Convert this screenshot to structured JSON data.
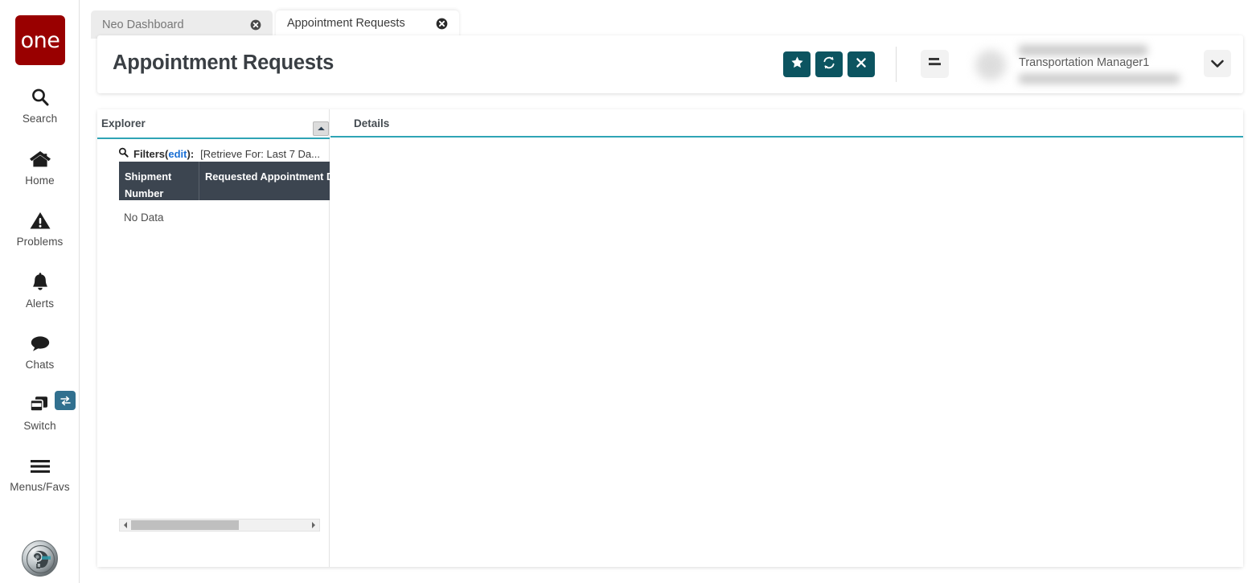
{
  "brand": {
    "logo_text": "one",
    "logo_color": "#990000"
  },
  "theme": {
    "accent_teal": "#0c5460",
    "panel_underline": "#2fa4b5",
    "grid_header_bg": "#3c4550",
    "link_blue": "#1a6fd4",
    "badge_blue": "#31708f"
  },
  "sidebar": {
    "items": [
      {
        "label": "Search",
        "icon": "search-icon"
      },
      {
        "label": "Home",
        "icon": "home-icon"
      },
      {
        "label": "Problems",
        "icon": "warning-triangle-icon"
      },
      {
        "label": "Alerts",
        "icon": "bell-icon"
      },
      {
        "label": "Chats",
        "icon": "chat-bubble-icon"
      },
      {
        "label": "Switch",
        "icon": "switch-windows-icon",
        "badge_icon": "swap-arrows-icon"
      },
      {
        "label": "Menus/Favs",
        "icon": "hamburger-icon"
      }
    ],
    "assistant_icon": "ai-assistant-orb-icon"
  },
  "tabs": [
    {
      "label": "Neo Dashboard",
      "active": false,
      "close_icon": "close-circle-icon"
    },
    {
      "label": "Appointment Requests",
      "active": true,
      "close_icon": "close-circle-icon"
    }
  ],
  "header": {
    "title": "Appointment Requests",
    "buttons": [
      {
        "name": "favorite-button",
        "icon": "star-icon"
      },
      {
        "name": "refresh-button",
        "icon": "refresh-icon"
      },
      {
        "name": "close-button",
        "icon": "x-icon"
      }
    ],
    "menu_button_icon": "list-align-icon",
    "user": {
      "role": "Transportation Manager1",
      "name_redacted": "",
      "org_redacted": "",
      "avatar_icon": "user-avatar",
      "chevron_icon": "chevron-down-icon"
    }
  },
  "explorer": {
    "title": "Explorer",
    "collapse_icon": "caret-up-icon",
    "filters": {
      "search_icon": "magnifier-icon",
      "label": "Filters",
      "open_paren": "(",
      "edit_link": "edit",
      "close_paren": "):",
      "value": "[Retrieve For: Last 7 Da..."
    },
    "grid": {
      "columns": [
        "Shipment Number",
        "Requested Appointment Date"
      ],
      "rows": [],
      "empty_message": "No Data"
    },
    "scrollbar": {
      "left_arrow_icon": "caret-left-icon",
      "right_arrow_icon": "caret-right-icon"
    }
  },
  "details": {
    "title": "Details",
    "body": ""
  }
}
